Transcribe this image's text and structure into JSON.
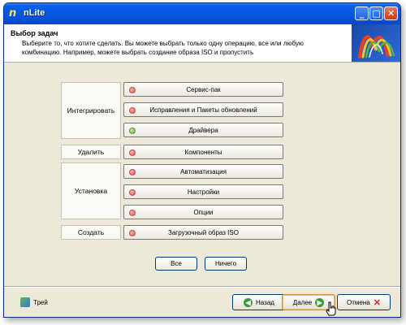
{
  "window": {
    "title": "nLite"
  },
  "titlebar_buttons": {
    "minimize": "_",
    "maximize": "□",
    "close": "✕"
  },
  "header": {
    "title": "Выбор задач",
    "description": "Выберите то, что хотите сделать. Вы можете выбрать только одну операцию, все или любую комбинацию. Например, можете выбрать создание образа ISO и пропустить"
  },
  "groups": [
    {
      "label": "Интегрировать"
    },
    {
      "label": "Удалить"
    },
    {
      "label": "Установка"
    },
    {
      "label": "Создать"
    }
  ],
  "tasks": [
    {
      "label": "Сервис-пак",
      "status": "red"
    },
    {
      "label": "Исправления и Пакеты обновлений",
      "status": "red"
    },
    {
      "label": "Драйвера",
      "status": "green"
    },
    {
      "label": "Компоненты",
      "status": "red"
    },
    {
      "label": "Автоматизация",
      "status": "red"
    },
    {
      "label": "Настройки",
      "status": "red"
    },
    {
      "label": "Опции",
      "status": "red"
    },
    {
      "label": "Загрузочный образ ISO",
      "status": "red"
    }
  ],
  "selection": {
    "all_label": "Все",
    "none_label": "Ничего"
  },
  "footer": {
    "tray_label": "Трей",
    "back_label": "Назад",
    "next_label": "Далее",
    "cancel_label": "Отмена"
  },
  "colors": {
    "accent": "#0655dd",
    "status_red": "#e05050",
    "status_green": "#5aa93a"
  }
}
